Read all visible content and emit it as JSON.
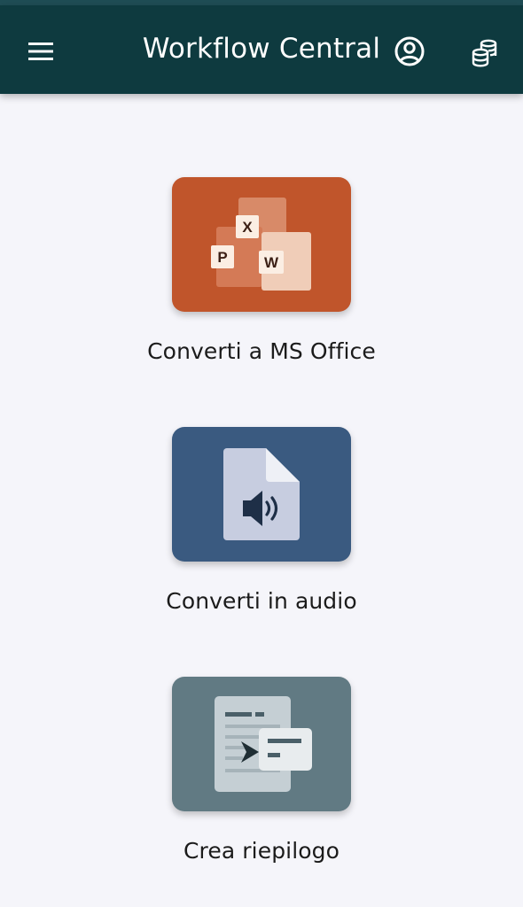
{
  "app": {
    "title": "Workflow Central"
  },
  "header": {
    "menu_icon": "hamburger-menu-icon",
    "account_icon": "account-circle-icon",
    "credits_icon": "coin-stack-icon"
  },
  "actions": [
    {
      "label": "Converti a MS Office",
      "icon": "ms-office-docs-icon",
      "color": "#c0552b",
      "badges": [
        "X",
        "P",
        "W"
      ]
    },
    {
      "label": "Converti in audio",
      "icon": "audio-file-icon",
      "color": "#3a5a80"
    },
    {
      "label": "Crea riepilogo",
      "icon": "summary-document-icon",
      "color": "#617a83"
    }
  ],
  "colors": {
    "app_bar": "#0e3a3f",
    "background": "#f5f5fa"
  }
}
